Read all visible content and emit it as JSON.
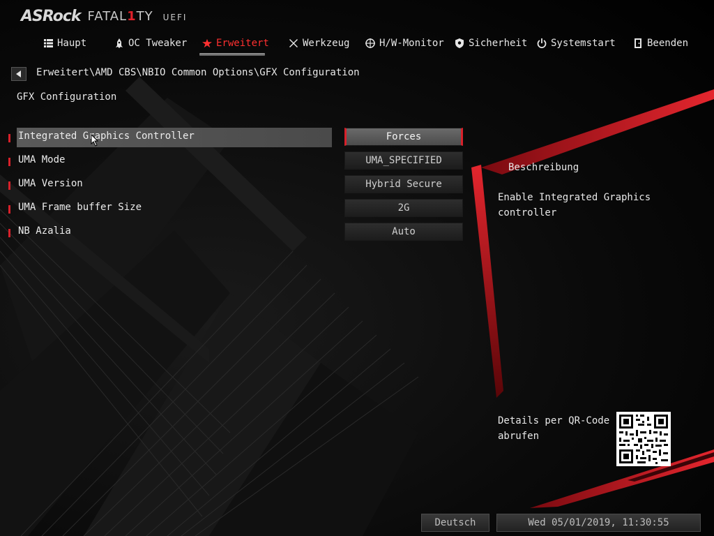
{
  "header": {
    "logo_brand": "ASRock",
    "logo_series_pre": "FATAL",
    "logo_series_mark": "1",
    "logo_series_post": "TY",
    "logo_uefi": "UEFI"
  },
  "nav": {
    "tabs": [
      {
        "label": "Haupt",
        "icon": "list-icon"
      },
      {
        "label": "OC Tweaker",
        "icon": "rocket-icon"
      },
      {
        "label": "Erweitert",
        "icon": "star-icon",
        "active": true
      },
      {
        "label": "Werkzeug",
        "icon": "tools-icon"
      },
      {
        "label": "H/W-Monitor",
        "icon": "crosshair-icon"
      },
      {
        "label": "Sicherheit",
        "icon": "shield-icon"
      },
      {
        "label": "Systemstart",
        "icon": "power-icon"
      },
      {
        "label": "Beenden",
        "icon": "exit-door-icon"
      }
    ]
  },
  "breadcrumb": {
    "path": "Erweitert\\AMD CBS\\NBIO Common Options\\GFX Configuration"
  },
  "page": {
    "title": "GFX Configuration"
  },
  "settings": [
    {
      "label": "Integrated Graphics Controller",
      "value": "Forces",
      "selected": true
    },
    {
      "label": "UMA Mode",
      "value": "UMA_SPECIFIED"
    },
    {
      "label": "UMA Version",
      "value": "Hybrid Secure"
    },
    {
      "label": "UMA Frame buffer Size",
      "value": "2G"
    },
    {
      "label": "NB Azalia",
      "value": "Auto"
    }
  ],
  "description": {
    "title": "Beschreibung",
    "text": "Enable Integrated Graphics controller"
  },
  "qr": {
    "label": "Details per QR-Code abrufen"
  },
  "footer": {
    "language": "Deutsch",
    "datetime": "Wed 05/01/2019, 11:30:55"
  },
  "colors": {
    "accent": "#d8202a",
    "active_tab": "#ff3030",
    "text": "#e8e8e8"
  }
}
